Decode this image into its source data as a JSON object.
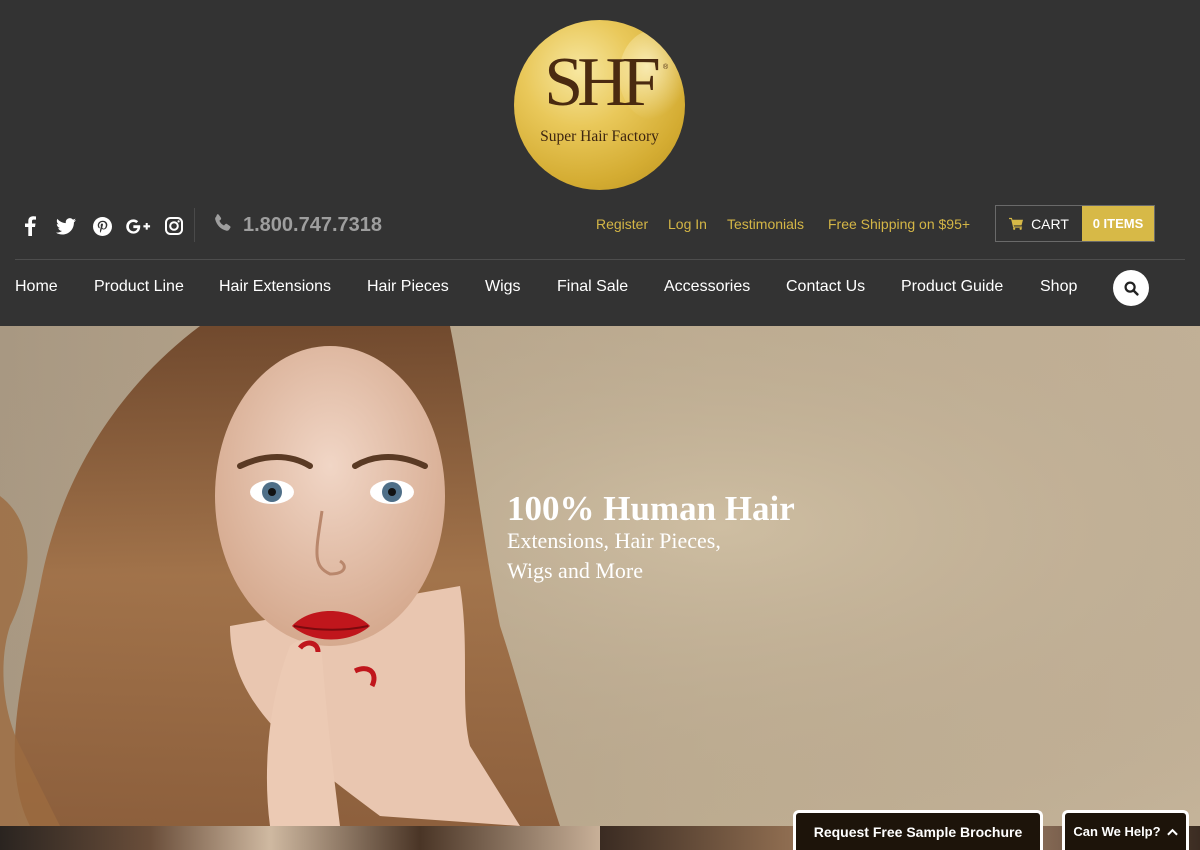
{
  "logo": {
    "monogram": "SHF",
    "reg_mark": "®",
    "brand_name": "Super Hair Factory"
  },
  "social": {
    "icons": [
      "facebook-icon",
      "twitter-icon",
      "pinterest-icon",
      "google-plus-icon",
      "instagram-icon"
    ]
  },
  "phone": {
    "number": "1.800.747.7318"
  },
  "top_links": {
    "register": "Register",
    "login": "Log In",
    "testimonials": "Testimonials",
    "shipping": "Free Shipping on $95+"
  },
  "cart": {
    "label": "CART",
    "items": "0 ITEMS"
  },
  "nav": {
    "items": [
      "Home",
      "Product Line",
      "Hair Extensions",
      "Hair Pieces",
      "Wigs",
      "Final Sale",
      "Accessories",
      "Contact Us",
      "Product Guide",
      "Shop"
    ]
  },
  "hero": {
    "title": "100% Human Hair",
    "subtitle_line1": "Extensions, Hair Pieces,",
    "subtitle_line2": "Wigs and More"
  },
  "floating": {
    "brochure": "Request Free Sample Brochure",
    "help": "Can We Help?"
  },
  "colors": {
    "header_bg": "#333333",
    "accent_gold": "#d7b947",
    "link_gold": "#d4b646",
    "nav_text": "#ffffff",
    "phone_gray": "#9e9e9e"
  }
}
